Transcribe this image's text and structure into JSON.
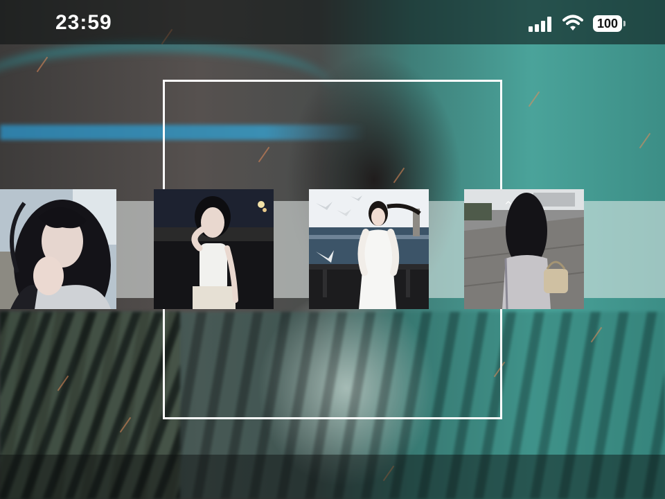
{
  "status_bar": {
    "time": "23:59",
    "battery": "100",
    "signal_icon": "cellular-signal-icon",
    "wifi_icon": "wifi-icon",
    "battery_icon": "battery-icon"
  },
  "colors": {
    "frame": "#ffffff",
    "status_text": "#ffffff"
  },
  "carousel": {
    "selected_index": 2,
    "thumbnails": [
      {
        "name": "thumbnail-1",
        "icon": "photo-girl-wind-hair"
      },
      {
        "name": "thumbnail-2",
        "icon": "photo-girl-night"
      },
      {
        "name": "thumbnail-3",
        "icon": "photo-girl-white-dress-sea"
      },
      {
        "name": "thumbnail-4",
        "icon": "photo-girl-back-street"
      }
    ]
  }
}
